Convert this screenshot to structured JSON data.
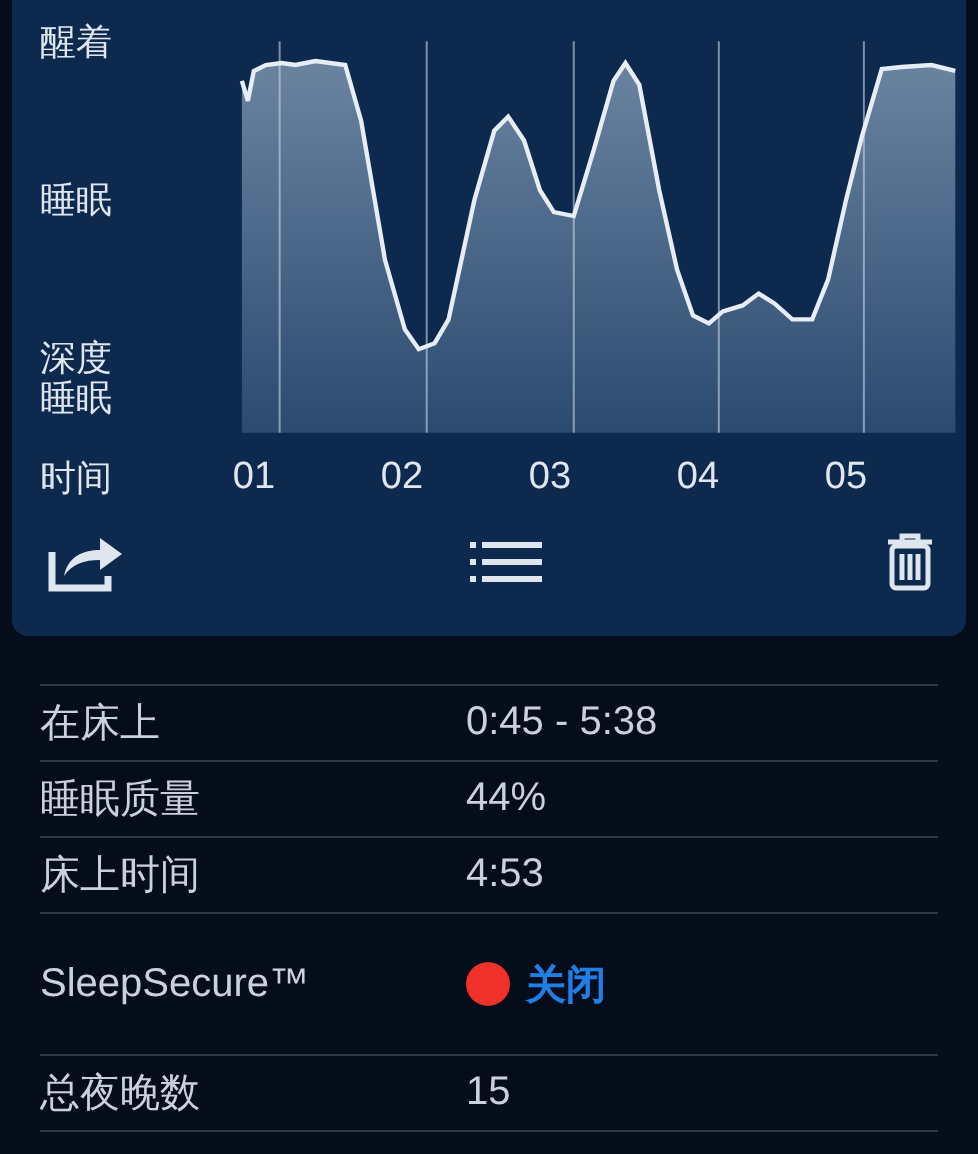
{
  "graph": {
    "y_labels": [
      "醒着",
      "睡眠",
      "深度睡眠"
    ],
    "time_label": "时间",
    "hours": [
      "01",
      "02",
      "03",
      "04",
      "05"
    ]
  },
  "stats": [
    {
      "kind": "text",
      "label": "在床上",
      "value": "0:45 - 5:38"
    },
    {
      "kind": "text",
      "label": "睡眠质量",
      "value": "44%"
    },
    {
      "kind": "text",
      "label": "床上时间",
      "value": "4:53"
    },
    {
      "kind": "status",
      "label": "SleepSecure™",
      "value": "关闭",
      "on": false
    },
    {
      "kind": "text",
      "label": "总夜晚数",
      "value": "15"
    }
  ]
}
